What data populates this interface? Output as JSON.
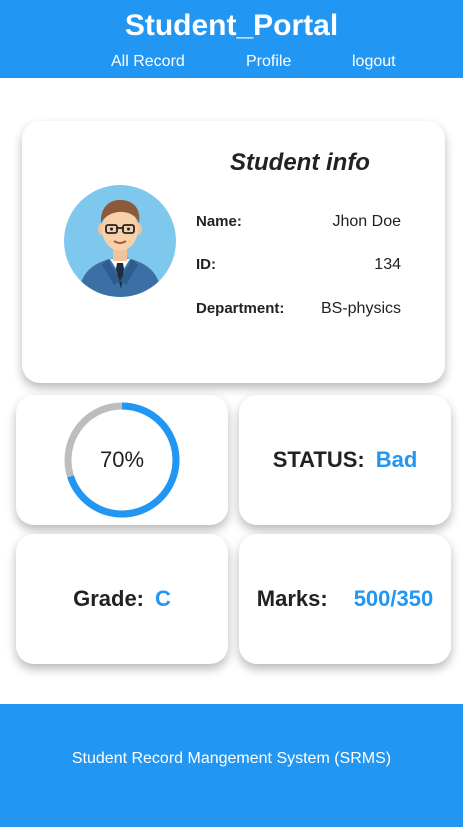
{
  "header": {
    "brand": "Student_Portal",
    "nav": [
      {
        "label": "All Record"
      },
      {
        "label": "Profile"
      },
      {
        "label": "logout"
      }
    ]
  },
  "student_info": {
    "title": "Student info",
    "fields": [
      {
        "label": "Name:",
        "value": "Jhon Doe"
      },
      {
        "label": "ID:",
        "value": "134"
      },
      {
        "label": "Department:",
        "value": "BS-physics"
      }
    ]
  },
  "progress": {
    "label": "70%",
    "value": 0.7
  },
  "status": {
    "label": "STATUS:",
    "value": "Bad"
  },
  "grade": {
    "label": "Grade:",
    "value": "C"
  },
  "marks": {
    "label": "Marks:",
    "value": "500/350"
  },
  "footer": {
    "text": "Student Record Mangement System (SRMS)"
  },
  "colors": {
    "primary": "#2196f3",
    "card_bg": "#ffffff",
    "text": "#222222"
  }
}
